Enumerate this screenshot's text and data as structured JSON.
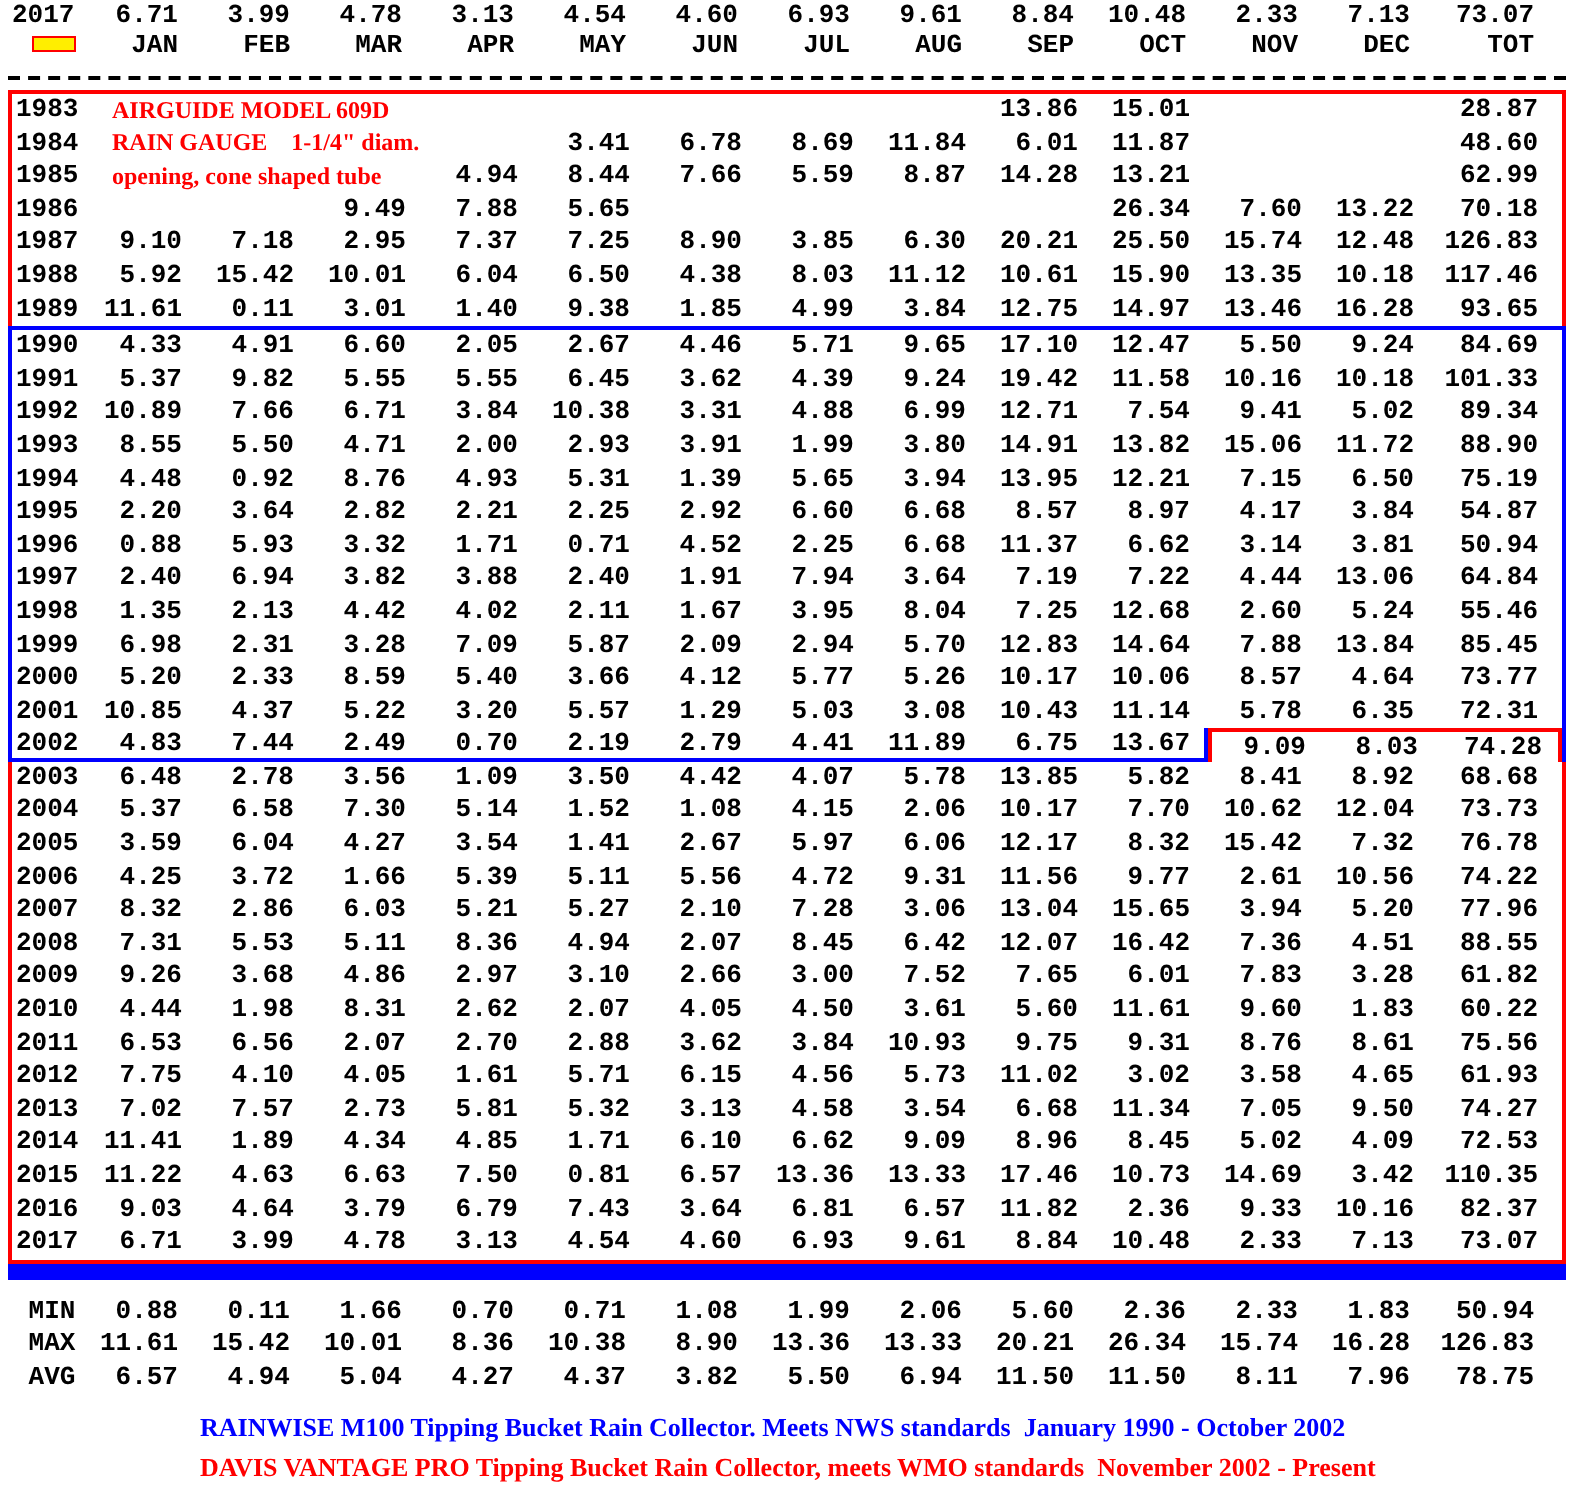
{
  "current": {
    "year": "2017",
    "values": [
      "6.71",
      "3.99",
      "4.78",
      "3.13",
      "4.54",
      "4.60",
      "6.93",
      "9.61",
      "8.84",
      "10.48",
      "2.33",
      "7.13"
    ],
    "total": "73.07"
  },
  "columns": {
    "months": [
      "JAN",
      "FEB",
      "MAR",
      "APR",
      "MAY",
      "JUN",
      "JUL",
      "AUG",
      "SEP",
      "OCT",
      "NOV",
      "DEC"
    ],
    "total": "TOT"
  },
  "sections": [
    {
      "color": "#ff0000",
      "rows": [
        {
          "kind": "partial",
          "year": "1983",
          "note": "AIRGUIDE MODEL 609D",
          "values": {
            "sep": "13.86",
            "oct": "15.01"
          },
          "total": "28.87"
        },
        {
          "kind": "partial",
          "year": "1984",
          "note": "RAIN GAUGE    1-1/4\" diam.",
          "values": {
            "may": "3.41",
            "jun": "6.78",
            "jul": "8.69",
            "aug": "11.84",
            "sep": "6.01",
            "oct": "11.87"
          },
          "total": "48.60"
        },
        {
          "kind": "partial",
          "year": "1985",
          "note": "opening, cone shaped tube",
          "values": {
            "apr": "4.94",
            "may": "8.44",
            "jun": "7.66",
            "jul": "5.59",
            "aug": "8.87",
            "sep": "14.28",
            "oct": "13.21"
          },
          "total": "62.99"
        },
        {
          "kind": "partial",
          "year": "1986",
          "values": {
            "mar": "9.49",
            "apr": "7.88",
            "may": "5.65",
            "oct": "26.34",
            "nov": "7.60",
            "dec": "13.22"
          },
          "total": "70.18"
        },
        {
          "kind": "plain",
          "year": "1987",
          "values": [
            "9.10",
            "7.18",
            "2.95",
            "7.37",
            "7.25",
            "8.90",
            "3.85",
            "6.30",
            "20.21",
            "25.50",
            "15.74",
            "12.48"
          ],
          "total": "126.83"
        },
        {
          "kind": "plain",
          "year": "1988",
          "values": [
            "5.92",
            "15.42",
            "10.01",
            "6.04",
            "6.50",
            "4.38",
            "8.03",
            "11.12",
            "10.61",
            "15.90",
            "13.35",
            "10.18"
          ],
          "total": "117.46"
        },
        {
          "kind": "plain",
          "year": "1989",
          "values": [
            "11.61",
            "0.11",
            "3.01",
            "1.40",
            "9.38",
            "1.85",
            "4.99",
            "3.84",
            "12.75",
            "14.97",
            "13.46",
            "16.28"
          ],
          "total": "93.65"
        }
      ]
    },
    {
      "color": "#0000ff",
      "rows": [
        {
          "kind": "plain",
          "year": "1990",
          "values": [
            "4.33",
            "4.91",
            "6.60",
            "2.05",
            "2.67",
            "4.46",
            "5.71",
            "9.65",
            "17.10",
            "12.47",
            "5.50",
            "9.24"
          ],
          "total": "84.69"
        },
        {
          "kind": "plain",
          "year": "1991",
          "values": [
            "5.37",
            "9.82",
            "5.55",
            "5.55",
            "6.45",
            "3.62",
            "4.39",
            "9.24",
            "19.42",
            "11.58",
            "10.16",
            "10.18"
          ],
          "total": "101.33"
        },
        {
          "kind": "plain",
          "year": "1992",
          "values": [
            "10.89",
            "7.66",
            "6.71",
            "3.84",
            "10.38",
            "3.31",
            "4.88",
            "6.99",
            "12.71",
            "7.54",
            "9.41",
            "5.02"
          ],
          "total": "89.34"
        },
        {
          "kind": "plain",
          "year": "1993",
          "values": [
            "8.55",
            "5.50",
            "4.71",
            "2.00",
            "2.93",
            "3.91",
            "1.99",
            "3.80",
            "14.91",
            "13.82",
            "15.06",
            "11.72"
          ],
          "total": "88.90"
        },
        {
          "kind": "plain",
          "year": "1994",
          "values": [
            "4.48",
            "0.92",
            "8.76",
            "4.93",
            "5.31",
            "1.39",
            "5.65",
            "3.94",
            "13.95",
            "12.21",
            "7.15",
            "6.50"
          ],
          "total": "75.19"
        },
        {
          "kind": "plain",
          "year": "1995",
          "values": [
            "2.20",
            "3.64",
            "2.82",
            "2.21",
            "2.25",
            "2.92",
            "6.60",
            "6.68",
            "8.57",
            "8.97",
            "4.17",
            "3.84"
          ],
          "total": "54.87"
        },
        {
          "kind": "plain",
          "year": "1996",
          "values": [
            "0.88",
            "5.93",
            "3.32",
            "1.71",
            "0.71",
            "4.52",
            "2.25",
            "6.68",
            "11.37",
            "6.62",
            "3.14",
            "3.81"
          ],
          "total": "50.94"
        },
        {
          "kind": "plain",
          "year": "1997",
          "values": [
            "2.40",
            "6.94",
            "3.82",
            "3.88",
            "2.40",
            "1.91",
            "7.94",
            "3.64",
            "7.19",
            "7.22",
            "4.44",
            "13.06"
          ],
          "total": "64.84"
        },
        {
          "kind": "plain",
          "year": "1998",
          "values": [
            "1.35",
            "2.13",
            "4.42",
            "4.02",
            "2.11",
            "1.67",
            "3.95",
            "8.04",
            "7.25",
            "12.68",
            "2.60",
            "5.24"
          ],
          "total": "55.46"
        },
        {
          "kind": "plain",
          "year": "1999",
          "values": [
            "6.98",
            "2.31",
            "3.28",
            "7.09",
            "5.87",
            "2.09",
            "2.94",
            "5.70",
            "12.83",
            "14.64",
            "7.88",
            "13.84"
          ],
          "total": "85.45"
        },
        {
          "kind": "plain",
          "year": "2000",
          "values": [
            "5.20",
            "2.33",
            "8.59",
            "5.40",
            "3.66",
            "4.12",
            "5.77",
            "5.26",
            "10.17",
            "10.06",
            "8.57",
            "4.64"
          ],
          "total": "73.77"
        },
        {
          "kind": "plain",
          "year": "2001",
          "values": [
            "10.85",
            "4.37",
            "5.22",
            "3.20",
            "5.57",
            "1.29",
            "5.03",
            "3.08",
            "10.43",
            "11.14",
            "5.78",
            "6.35"
          ],
          "total": "72.31"
        },
        {
          "kind": "transition",
          "year": "2002",
          "values": [
            "4.83",
            "7.44",
            "2.49",
            "0.70",
            "2.19",
            "2.79",
            "4.41",
            "11.89",
            "6.75",
            "13.67",
            "9.09",
            "8.03"
          ],
          "total": "74.28"
        }
      ]
    },
    {
      "color": "#ff0000",
      "rows": [
        {
          "kind": "plain",
          "year": "2003",
          "values": [
            "6.48",
            "2.78",
            "3.56",
            "1.09",
            "3.50",
            "4.42",
            "4.07",
            "5.78",
            "13.85",
            "5.82",
            "8.41",
            "8.92"
          ],
          "total": "68.68"
        },
        {
          "kind": "plain",
          "year": "2004",
          "values": [
            "5.37",
            "6.58",
            "7.30",
            "5.14",
            "1.52",
            "1.08",
            "4.15",
            "2.06",
            "10.17",
            "7.70",
            "10.62",
            "12.04"
          ],
          "total": "73.73"
        },
        {
          "kind": "plain",
          "year": "2005",
          "values": [
            "3.59",
            "6.04",
            "4.27",
            "3.54",
            "1.41",
            "2.67",
            "5.97",
            "6.06",
            "12.17",
            "8.32",
            "15.42",
            "7.32"
          ],
          "total": "76.78"
        },
        {
          "kind": "plain",
          "year": "2006",
          "values": [
            "4.25",
            "3.72",
            "1.66",
            "5.39",
            "5.11",
            "5.56",
            "4.72",
            "9.31",
            "11.56",
            "9.77",
            "2.61",
            "10.56"
          ],
          "total": "74.22"
        },
        {
          "kind": "plain",
          "year": "2007",
          "values": [
            "8.32",
            "2.86",
            "6.03",
            "5.21",
            "5.27",
            "2.10",
            "7.28",
            "3.06",
            "13.04",
            "15.65",
            "3.94",
            "5.20"
          ],
          "total": "77.96"
        },
        {
          "kind": "plain",
          "year": "2008",
          "values": [
            "7.31",
            "5.53",
            "5.11",
            "8.36",
            "4.94",
            "2.07",
            "8.45",
            "6.42",
            "12.07",
            "16.42",
            "7.36",
            "4.51"
          ],
          "total": "88.55"
        },
        {
          "kind": "plain",
          "year": "2009",
          "values": [
            "9.26",
            "3.68",
            "4.86",
            "2.97",
            "3.10",
            "2.66",
            "3.00",
            "7.52",
            "7.65",
            "6.01",
            "7.83",
            "3.28"
          ],
          "total": "61.82"
        },
        {
          "kind": "plain",
          "year": "2010",
          "values": [
            "4.44",
            "1.98",
            "8.31",
            "2.62",
            "2.07",
            "4.05",
            "4.50",
            "3.61",
            "5.60",
            "11.61",
            "9.60",
            "1.83"
          ],
          "total": "60.22"
        },
        {
          "kind": "plain",
          "year": "2011",
          "values": [
            "6.53",
            "6.56",
            "2.07",
            "2.70",
            "2.88",
            "3.62",
            "3.84",
            "10.93",
            "9.75",
            "9.31",
            "8.76",
            "8.61"
          ],
          "total": "75.56"
        },
        {
          "kind": "plain",
          "year": "2012",
          "values": [
            "7.75",
            "4.10",
            "4.05",
            "1.61",
            "5.71",
            "6.15",
            "4.56",
            "5.73",
            "11.02",
            "3.02",
            "3.58",
            "4.65"
          ],
          "total": "61.93"
        },
        {
          "kind": "plain",
          "year": "2013",
          "values": [
            "7.02",
            "7.57",
            "2.73",
            "5.81",
            "5.32",
            "3.13",
            "4.58",
            "3.54",
            "6.68",
            "11.34",
            "7.05",
            "9.50"
          ],
          "total": "74.27"
        },
        {
          "kind": "plain",
          "year": "2014",
          "values": [
            "11.41",
            "1.89",
            "4.34",
            "4.85",
            "1.71",
            "6.10",
            "6.62",
            "9.09",
            "8.96",
            "8.45",
            "5.02",
            "4.09"
          ],
          "total": "72.53"
        },
        {
          "kind": "plain",
          "year": "2015",
          "values": [
            "11.22",
            "4.63",
            "6.63",
            "7.50",
            "0.81",
            "6.57",
            "13.36",
            "13.33",
            "17.46",
            "10.73",
            "14.69",
            "3.42"
          ],
          "total": "110.35"
        },
        {
          "kind": "plain",
          "year": "2016",
          "values": [
            "9.03",
            "4.64",
            "3.79",
            "6.79",
            "7.43",
            "3.64",
            "6.81",
            "6.57",
            "11.82",
            "2.36",
            "9.33",
            "10.16"
          ],
          "total": "82.37"
        },
        {
          "kind": "plain",
          "year": "2017",
          "values": [
            "6.71",
            "3.99",
            "4.78",
            "3.13",
            "4.54",
            "4.60",
            "6.93",
            "9.61",
            "8.84",
            "10.48",
            "2.33",
            "7.13"
          ],
          "total": "73.07"
        }
      ]
    }
  ],
  "summary": [
    {
      "label": "MIN",
      "values": [
        "0.88",
        "0.11",
        "1.66",
        "0.70",
        "0.71",
        "1.08",
        "1.99",
        "2.06",
        "5.60",
        "2.36",
        "2.33",
        "1.83"
      ],
      "total": "50.94"
    },
    {
      "label": "MAX",
      "values": [
        "11.61",
        "15.42",
        "10.01",
        "8.36",
        "10.38",
        "8.90",
        "13.36",
        "13.33",
        "20.21",
        "26.34",
        "15.74",
        "16.28"
      ],
      "total": "126.83"
    },
    {
      "label": "AVG",
      "values": [
        "6.57",
        "4.94",
        "5.04",
        "4.27",
        "4.37",
        "3.82",
        "5.50",
        "6.94",
        "11.50",
        "11.50",
        "8.11",
        "7.96"
      ],
      "total": "78.75"
    }
  ],
  "footnotes": [
    {
      "text": "RAINWISE M100 Tipping Bucket Rain Collector. Meets NWS standards  January 1990 - October 2002",
      "color": "#0000ff"
    },
    {
      "text": "DAVIS VANTAGE PRO Tipping Bucket Rain Collector, meets WMO standards  November 2002 - Present",
      "color": "#ff0000"
    }
  ]
}
